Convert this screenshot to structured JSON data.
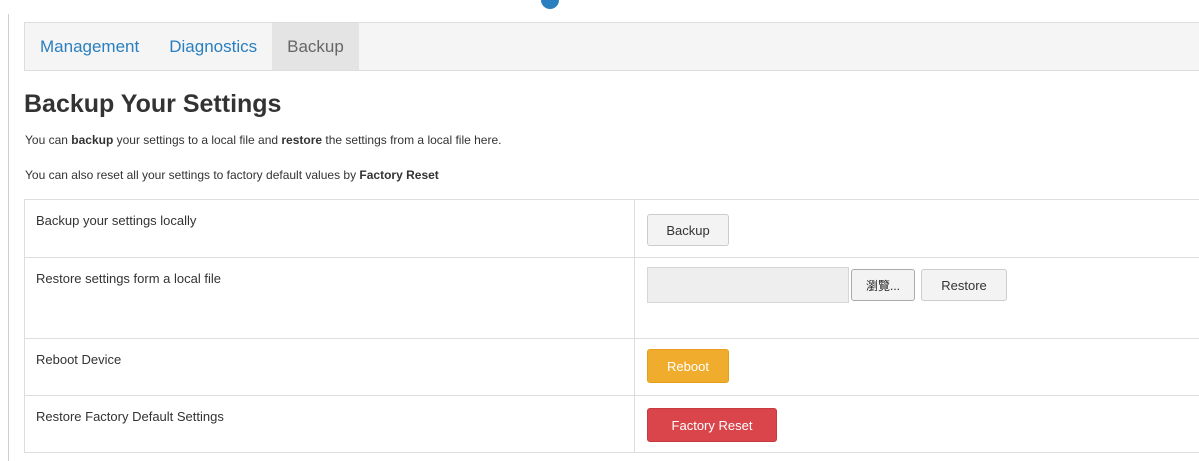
{
  "tabs": [
    {
      "label": "Management",
      "active": false
    },
    {
      "label": "Diagnostics",
      "active": false
    },
    {
      "label": "Backup",
      "active": true
    }
  ],
  "heading": "Backup Your Settings",
  "description": {
    "line1": {
      "pre": "You can ",
      "bold1": "backup",
      "mid": " your settings to a local file and ",
      "bold2": "restore",
      "post": " the settings from a local file here."
    },
    "line2": {
      "pre": "You can also reset all your settings to factory default values by ",
      "bold": "Factory Reset"
    }
  },
  "rows": {
    "backup": {
      "label": "Backup your settings locally",
      "button": "Backup"
    },
    "restore": {
      "label": "Restore settings form a local file",
      "browse": "瀏覽...",
      "file_value": "",
      "button": "Restore"
    },
    "reboot": {
      "label": "Reboot Device",
      "button": "Reboot"
    },
    "factory": {
      "label": "Restore Factory Default Settings",
      "button": "Factory Reset"
    }
  },
  "colors": {
    "link": "#2a7fbf",
    "warning": "#f0ad2d",
    "danger": "#d9454a"
  }
}
